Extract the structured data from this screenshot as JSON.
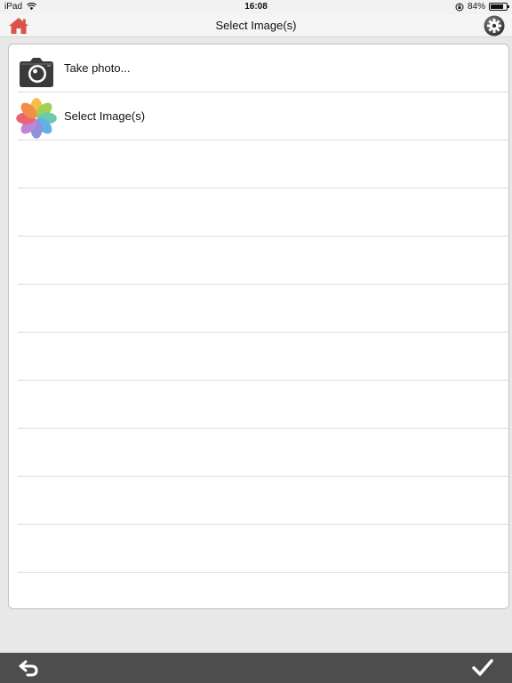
{
  "status_bar": {
    "device": "iPad",
    "time": "16:08",
    "battery_text": "84%",
    "battery_level": 0.84
  },
  "nav": {
    "title": "Select Image(s)",
    "home_icon": "home-icon",
    "settings_icon": "gear-icon"
  },
  "list": {
    "items": [
      {
        "label": "Take photo...",
        "icon": "camera-icon"
      },
      {
        "label": "Select Image(s)",
        "icon": "photos-icon"
      }
    ],
    "empty_rows": 9
  },
  "toolbar": {
    "back_icon": "undo-arrow-icon",
    "done_icon": "checkmark-icon"
  },
  "colors": {
    "home_red": "#d9534a",
    "toolbar_bg": "#4d4d4d",
    "background": "#e8e8e8"
  }
}
